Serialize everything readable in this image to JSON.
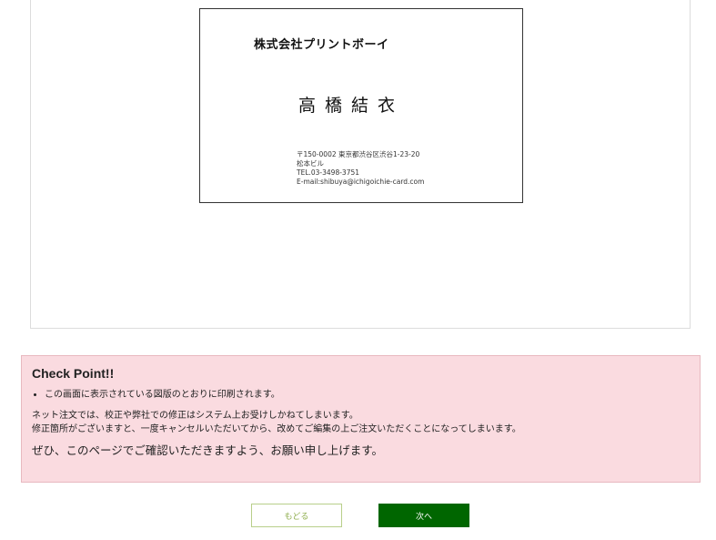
{
  "card": {
    "company": "株式会社プリントボーイ",
    "name": "高橋結衣",
    "address_lines": [
      "〒150-0002 東京都渋谷区渋谷1-23-20",
      "松本ビル",
      "TEL.03-3498-3751",
      "E-mail:shibuya@ichigoichie-card.com"
    ]
  },
  "checkpoint": {
    "title": "Check Point!!",
    "bullets": [
      "この画面に表示されている図版のとおりに印刷されます。"
    ],
    "note_lines": [
      "ネット注文では、校正や弊社での修正はシステム上お受けしかねてしまいます。",
      "修正箇所がございますと、一度キャンセルいただいてから、改めてご編集の上ご注文いただくことになってしまいます。"
    ],
    "emphasis": "ぜひ、このページでご確認いただきますよう、お願い申し上げます。"
  },
  "buttons": {
    "back_label": "もどる",
    "next_label": "次へ"
  },
  "colors": {
    "checkpoint_bg": "#fadbe0",
    "next_button_bg": "#006600",
    "back_button_text": "#8fae4e"
  }
}
